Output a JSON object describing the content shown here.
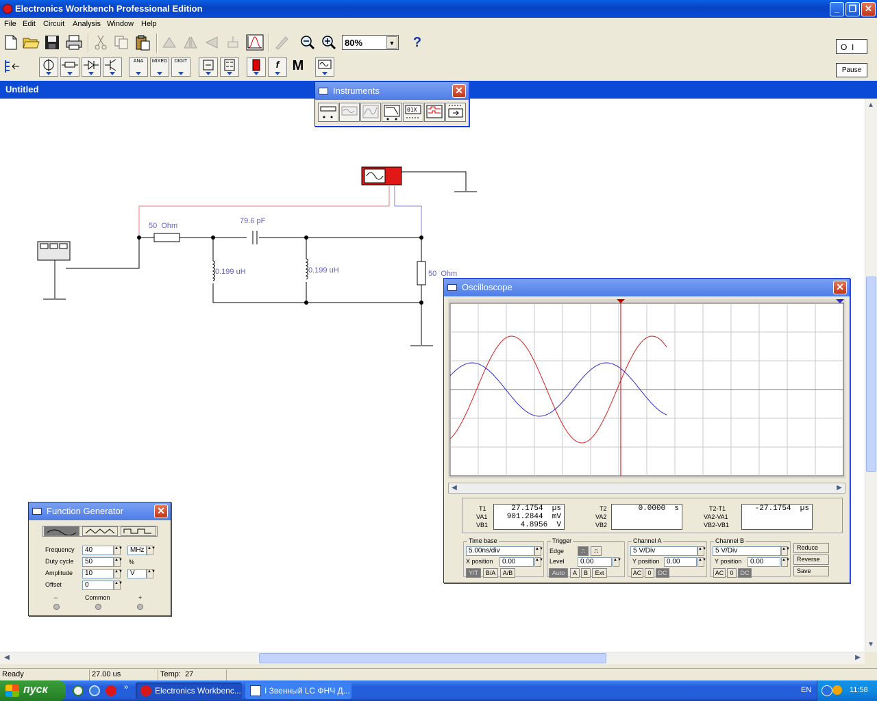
{
  "app": {
    "title": "Electronics Workbench Professional Edition"
  },
  "menu": [
    "File",
    "Edit",
    "Circuit",
    "Analysis",
    "Window",
    "Help"
  ],
  "toolbar": {
    "zoom": "80%",
    "help": "?",
    "pause": "Pause",
    "power": "O  I"
  },
  "components_bar": {
    "analog": "ANA",
    "mixed": "MIXED",
    "digital": "DIGIT",
    "misc": "M",
    "func": "f"
  },
  "document": {
    "title": "Untitled"
  },
  "circuit": {
    "r1": "50  Ohm",
    "c1": "79.6 pF",
    "l1": "0.199 uH",
    "l2": "0.199 uH",
    "r2": "50  Ohm"
  },
  "instruments": {
    "title": "Instruments"
  },
  "oscilloscope": {
    "title": "Oscilloscope",
    "t1_label": "T1",
    "va1_label": "VA1",
    "vb1_label": "VB1",
    "t1": "27.1754  µs",
    "va1": "901.2844  mV",
    "vb1": "4.8956  V",
    "t2_label": "T2",
    "va2_label": "VA2",
    "vb2_label": "VB2",
    "t2": "0.0000  s",
    "dt_label": "T2-T1",
    "dva_label": "VA2-VA1",
    "dvb_label": "VB2-VB1",
    "dt": "-27.1754  µs",
    "timebase_title": "Time base",
    "timebase": "5.00ns/div",
    "xpos_label": "X position",
    "xpos": "0.00",
    "yt": "Y/T",
    "ba": "B/A",
    "ab": "A/B",
    "trigger_title": "Trigger",
    "edge_label": "Edge",
    "level_label": "Level",
    "level": "0.00",
    "auto": "Auto",
    "trig_a": "A",
    "trig_b": "B",
    "trig_ext": "Ext",
    "cha_title": "Channel A",
    "cha_scale": "5  V/Div",
    "cha_ypos_label": "Y position",
    "cha_ypos": "0.00",
    "chb_title": "Channel B",
    "chb_scale": "5  V/Div",
    "chb_ypos_label": "Y position",
    "chb_ypos": "0.00",
    "ac": "AC",
    "zero": "0",
    "dc": "DC",
    "reduce": "Reduce",
    "reverse": "Reverse",
    "save": "Save",
    "colors": {
      "channel_a": "#d81c1c",
      "channel_b": "#2a2ad0",
      "cursor1": "#c00000"
    }
  },
  "function_generator": {
    "title": "Function Generator",
    "frequency_label": "Frequency",
    "frequency": "40",
    "frequency_unit": "MHz",
    "duty_label": "Duty cycle",
    "duty": "50",
    "duty_unit": "%",
    "amplitude_label": "Amplitude",
    "amplitude": "10",
    "amplitude_unit": "V",
    "offset_label": "Offset",
    "offset": "0",
    "minus": "–",
    "common": "Common",
    "plus": "+"
  },
  "statusbar": {
    "state": "Ready",
    "time": "27.00 us",
    "temp": "Temp:  27"
  },
  "taskbar": {
    "start": "пуск",
    "task1": "Electronics Workbenc...",
    "task2": "I Звенный LC ФНЧ Д...",
    "lang": "EN",
    "clock": "11:58"
  }
}
